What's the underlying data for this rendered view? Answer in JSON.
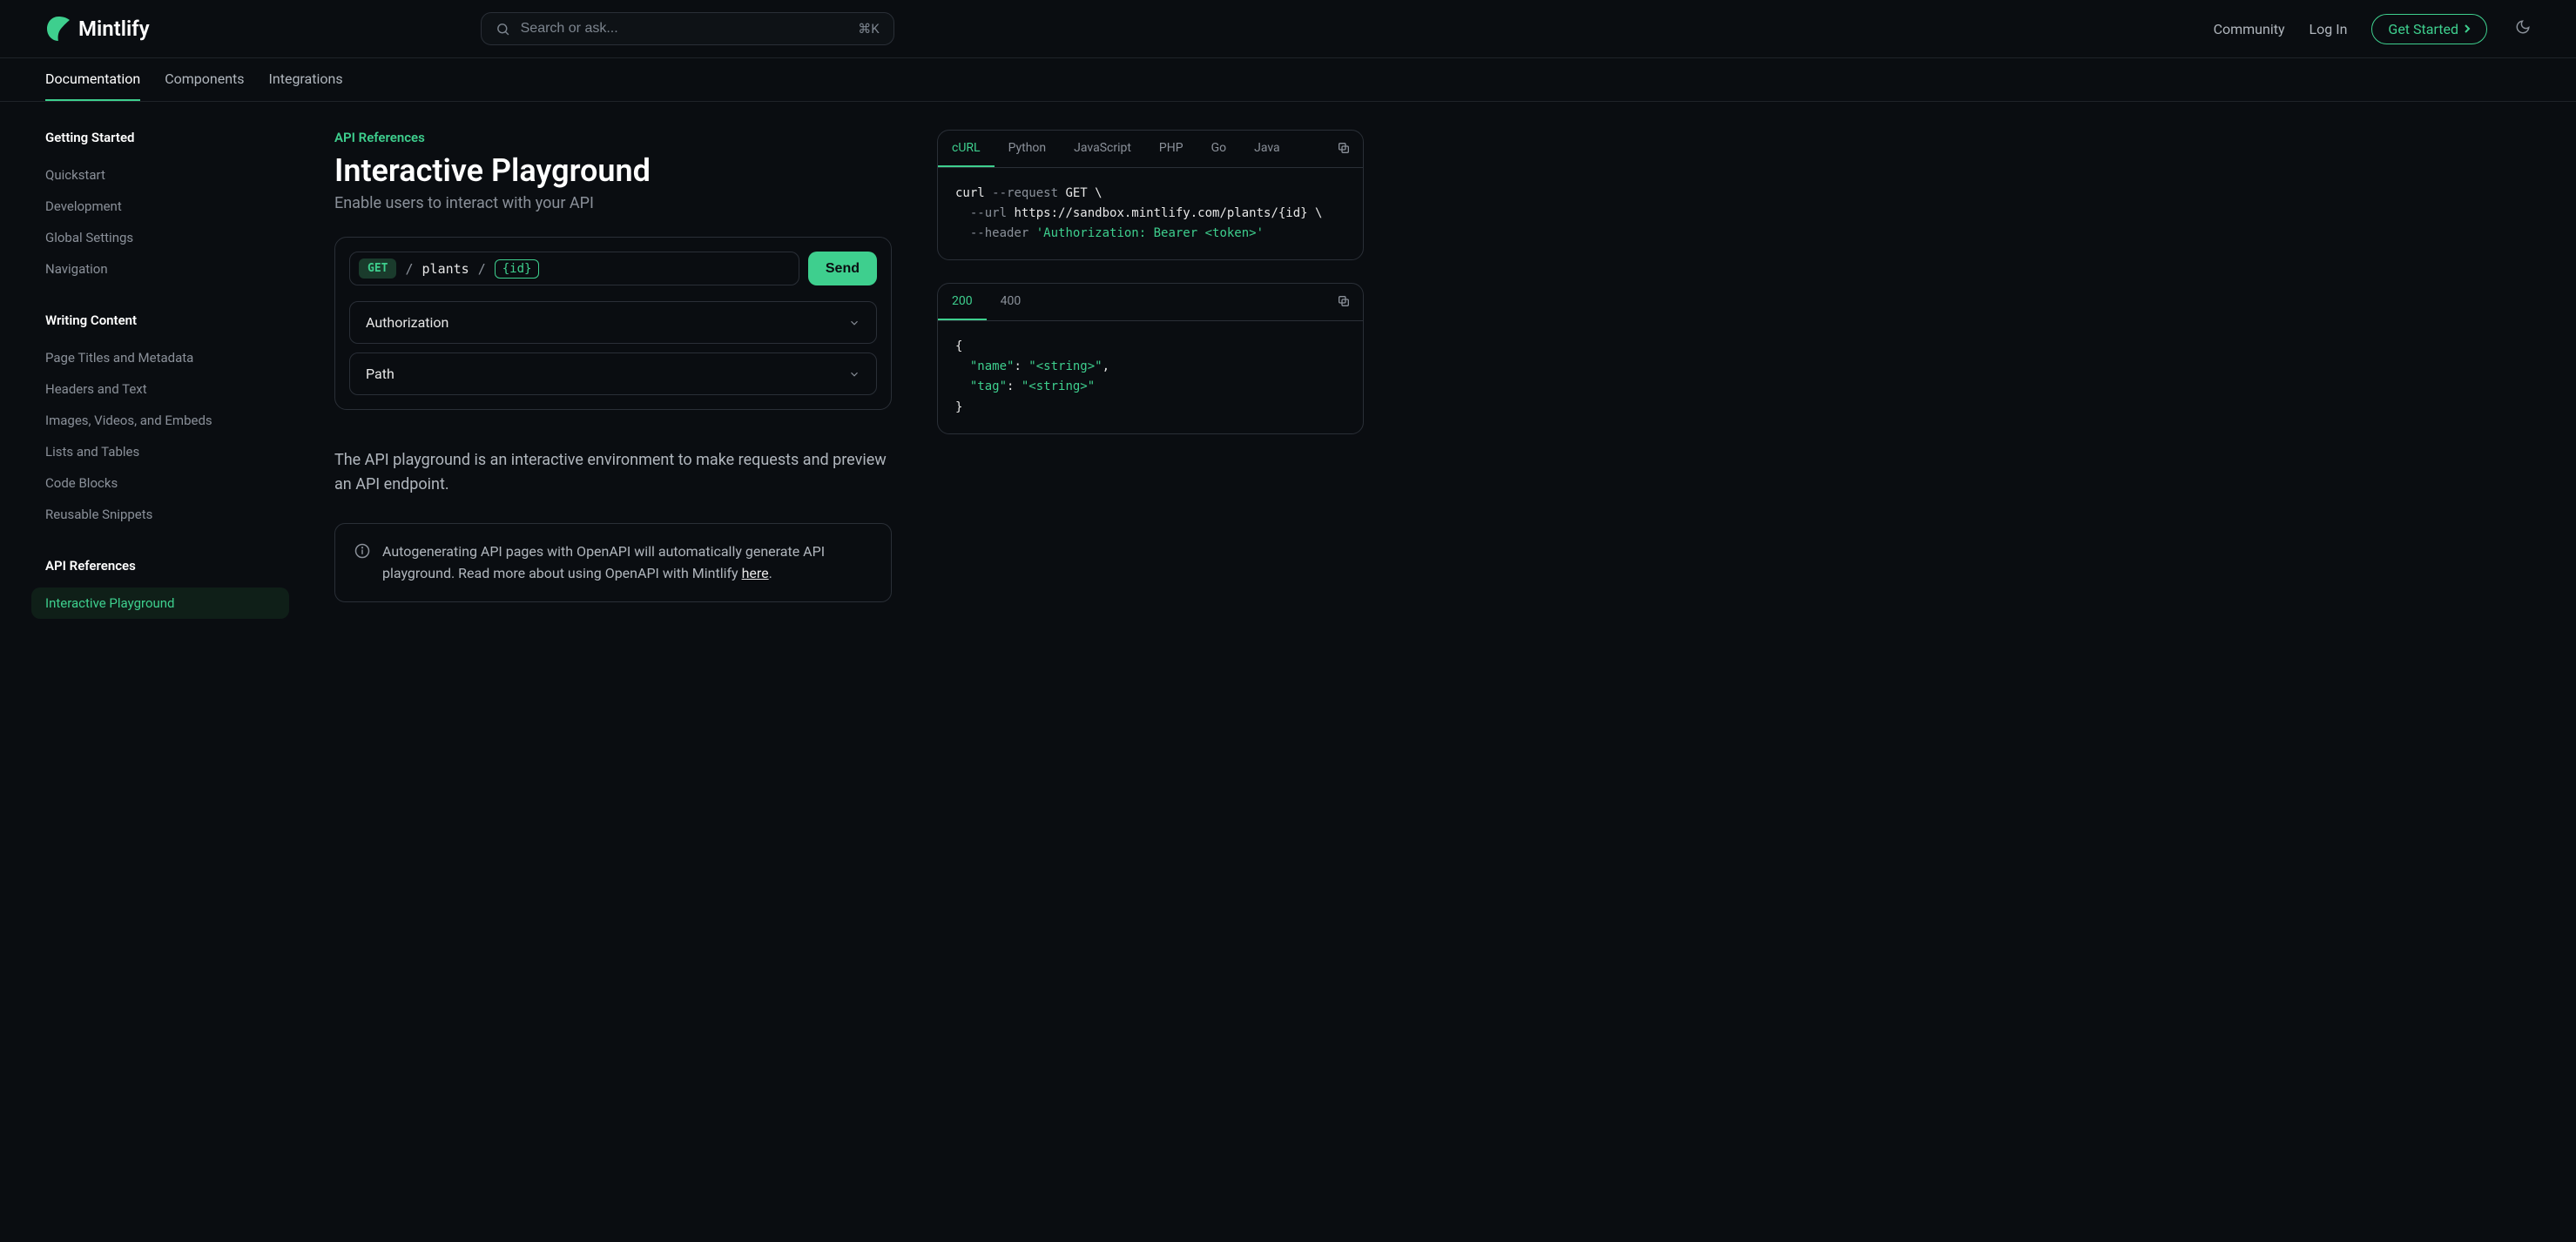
{
  "header": {
    "brand": "Mintlify",
    "search_placeholder": "Search or ask...",
    "search_shortcut": "⌘K",
    "links": [
      "Community",
      "Log In"
    ],
    "cta": "Get Started"
  },
  "nav_tabs": [
    "Documentation",
    "Components",
    "Integrations"
  ],
  "nav_active": 0,
  "sidebar": [
    {
      "heading": "Getting Started",
      "items": [
        "Quickstart",
        "Development",
        "Global Settings",
        "Navigation"
      ]
    },
    {
      "heading": "Writing Content",
      "items": [
        "Page Titles and Metadata",
        "Headers and Text",
        "Images, Videos, and Embeds",
        "Lists and Tables",
        "Code Blocks",
        "Reusable Snippets"
      ]
    },
    {
      "heading": "API References",
      "items": [
        "Interactive Playground"
      ]
    }
  ],
  "sidebar_active": "Interactive Playground",
  "page": {
    "breadcrumb": "API References",
    "title": "Interactive Playground",
    "subtitle": "Enable users to interact with your API"
  },
  "playground": {
    "method": "GET",
    "path_segments": [
      "/",
      "plants",
      "/"
    ],
    "path_param": "{id}",
    "send_label": "Send",
    "sections": [
      "Authorization",
      "Path"
    ]
  },
  "body_text": "The API playground is an interactive environment to make requests and preview an API endpoint.",
  "callout": {
    "text_before": "Autogenerating API pages with OpenAPI will automatically generate API playground. Read more about using OpenAPI with Mintlify ",
    "link_text": "here",
    "text_after": "."
  },
  "code_request": {
    "tabs": [
      "cURL",
      "Python",
      "JavaScript",
      "PHP",
      "Go",
      "Java"
    ],
    "active": 0,
    "lines": [
      {
        "cmd": "curl ",
        "flag": "--request",
        "rest": " GET \\"
      },
      {
        "indent": "  ",
        "flag": "--url",
        "rest": " https://sandbox.mintlify.com/plants/{id} \\"
      },
      {
        "indent": "  ",
        "flag": "--header",
        "str": " 'Authorization: Bearer <token>'"
      }
    ]
  },
  "code_response": {
    "tabs": [
      "200",
      "400"
    ],
    "active": 0,
    "json": {
      "open": "{",
      "rows": [
        {
          "key": "\"name\"",
          "val": "\"<string>\"",
          "comma": ","
        },
        {
          "key": "\"tag\"",
          "val": "\"<string>\"",
          "comma": ""
        }
      ],
      "close": "}"
    }
  }
}
